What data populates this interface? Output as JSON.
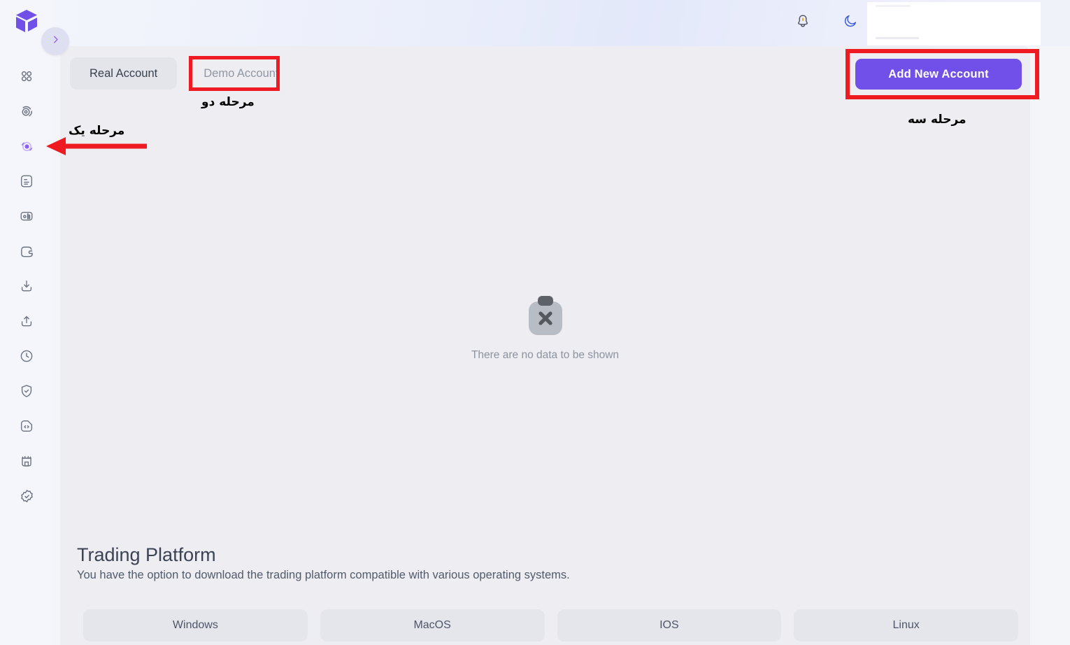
{
  "app": {
    "logo_name": "cube-logo",
    "expand_icon": "chevron-right-icon"
  },
  "sidebar": {
    "items": [
      {
        "icon": "grid-dashboard-icon",
        "name": "sidebar-item-dashboard",
        "active": false
      },
      {
        "icon": "coins-exchange-icon",
        "name": "sidebar-item-exchange",
        "active": false
      },
      {
        "icon": "accounts-circle-icon",
        "name": "sidebar-item-accounts",
        "active": true
      },
      {
        "icon": "document-icon",
        "name": "sidebar-item-reports",
        "active": false
      },
      {
        "icon": "bar-chart-icon",
        "name": "sidebar-item-analytics",
        "active": false
      },
      {
        "icon": "wallet-icon",
        "name": "sidebar-item-wallet",
        "active": false
      },
      {
        "icon": "download-icon",
        "name": "sidebar-item-deposit",
        "active": false
      },
      {
        "icon": "upload-icon",
        "name": "sidebar-item-withdraw",
        "active": false
      },
      {
        "icon": "clock-icon",
        "name": "sidebar-item-history",
        "active": false
      },
      {
        "icon": "shield-check-icon",
        "name": "sidebar-item-verification",
        "active": false
      },
      {
        "icon": "code-file-icon",
        "name": "sidebar-item-api",
        "active": false
      },
      {
        "icon": "gift-box-icon",
        "name": "sidebar-item-rewards",
        "active": false
      },
      {
        "icon": "verified-badge-icon",
        "name": "sidebar-item-certificate",
        "active": false
      }
    ]
  },
  "topbar": {
    "bell_icon": "notification-bell-icon",
    "theme_icon": "moon-dark-mode-icon"
  },
  "tabs": [
    {
      "label": "Real Account",
      "active": true
    },
    {
      "label": "Demo Account",
      "active": false
    }
  ],
  "actions": {
    "add_new_account": "Add New Account"
  },
  "empty_state": {
    "icon": "clipboard-x-icon",
    "message": "There are no data to be shown"
  },
  "trading_platform": {
    "title": "Trading Platform",
    "subtitle": "You have the option to download the trading platform compatible with various operating systems.",
    "buttons": [
      "Windows",
      "MacOS",
      "IOS",
      "Linux"
    ]
  },
  "annotations": {
    "stage_one": "مرحله یک",
    "stage_two": "مرحله دو",
    "stage_three": "مرحله سه",
    "highlight_color": "#ee1c22"
  },
  "colors": {
    "accent": "#7150ea",
    "panel": "#ededf2",
    "sidebar": "#f5f6fb",
    "tab_active": "#e4e5ea"
  }
}
